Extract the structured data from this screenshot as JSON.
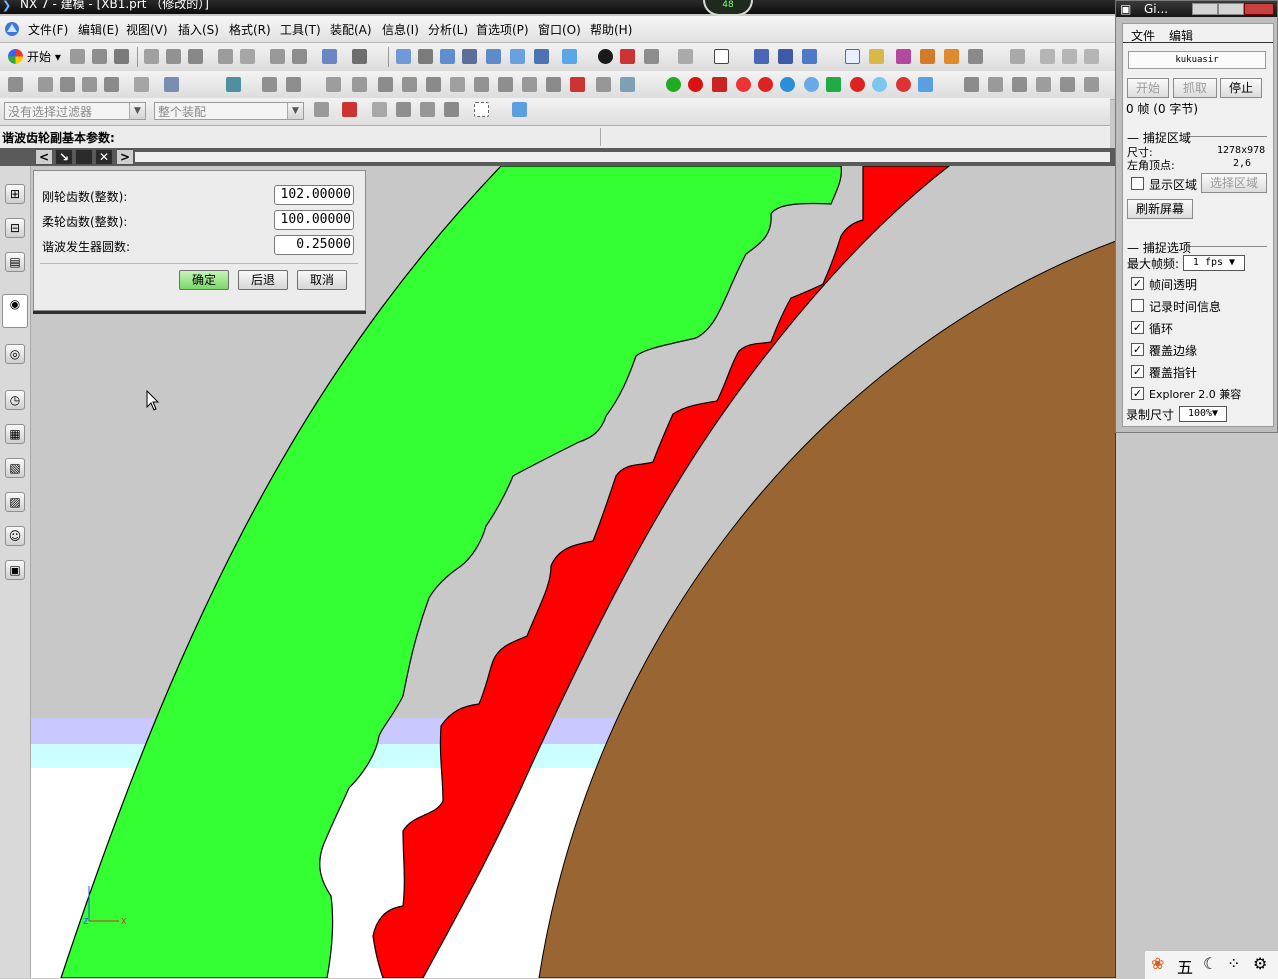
{
  "window": {
    "title": "NX 7 - 建模 - [XB1.prt （修改的）]",
    "record_badge": "48"
  },
  "menubar": {
    "items": [
      "文件(F)",
      "编辑(E)",
      "视图(V)",
      "插入(S)",
      "格式(R)",
      "工具(T)",
      "装配(A)",
      "信息(I)",
      "分析(L)",
      "首选项(P)",
      "窗口(O)",
      "帮助(H)"
    ]
  },
  "toolbar": {
    "start_label": "开始"
  },
  "filterbar": {
    "selection_filter": "没有选择过滤器",
    "scope": "整个装配"
  },
  "cue_line": {
    "text": "谐波齿轮副基本参数:"
  },
  "dialog": {
    "fields": [
      {
        "label": "刚轮齿数(整数):",
        "value": "102.00000"
      },
      {
        "label": "柔轮齿数(整数):",
        "value": "100.00000"
      },
      {
        "label": "谐波发生器圆数:",
        "value": "0.25000"
      }
    ],
    "buttons": {
      "ok": "确定",
      "back": "后退",
      "cancel": "取消"
    }
  },
  "gif_recorder": {
    "title": "Gi...",
    "menu": [
      "文件",
      "编辑"
    ],
    "name": "kukuasir",
    "buttons": {
      "start": "开始",
      "grab": "抓取",
      "stop": "停止"
    },
    "frames_text": "0 帧 (0 字节)",
    "capture_area": {
      "heading": "捕捉区域",
      "size_label": "尺寸:",
      "size_value": "1278x978",
      "origin_label": "左角顶点:",
      "origin_value": "2,6",
      "show_area_label": "显示区域",
      "show_area_checked": false,
      "select_area": "选择区域",
      "refresh": "刷新屏幕"
    },
    "capture_options": {
      "heading": "捕捉选项",
      "max_fps_label": "最大帧频:",
      "max_fps_value": "1 fps",
      "options": [
        {
          "label": "帧间透明",
          "checked": true
        },
        {
          "label": "记录时间信息",
          "checked": false
        },
        {
          "label": "循环",
          "checked": true
        },
        {
          "label": "覆盖边缘",
          "checked": true
        },
        {
          "label": "覆盖指针",
          "checked": true
        },
        {
          "label": "Explorer 2.0 兼容",
          "checked": true
        }
      ],
      "record_size_label": "录制尺寸",
      "record_size_value": "100%"
    }
  },
  "triad": {
    "x_label": "X",
    "z_label": "Z"
  },
  "tray": {
    "ime_label": "五"
  },
  "colors": {
    "green_gear": "#33ff33",
    "red_gear": "#ff0000",
    "brown_generator": "#996633",
    "background": "#c8c8c8",
    "band_lavender": "#c9c9ff",
    "band_cyan": "#ccffff"
  }
}
